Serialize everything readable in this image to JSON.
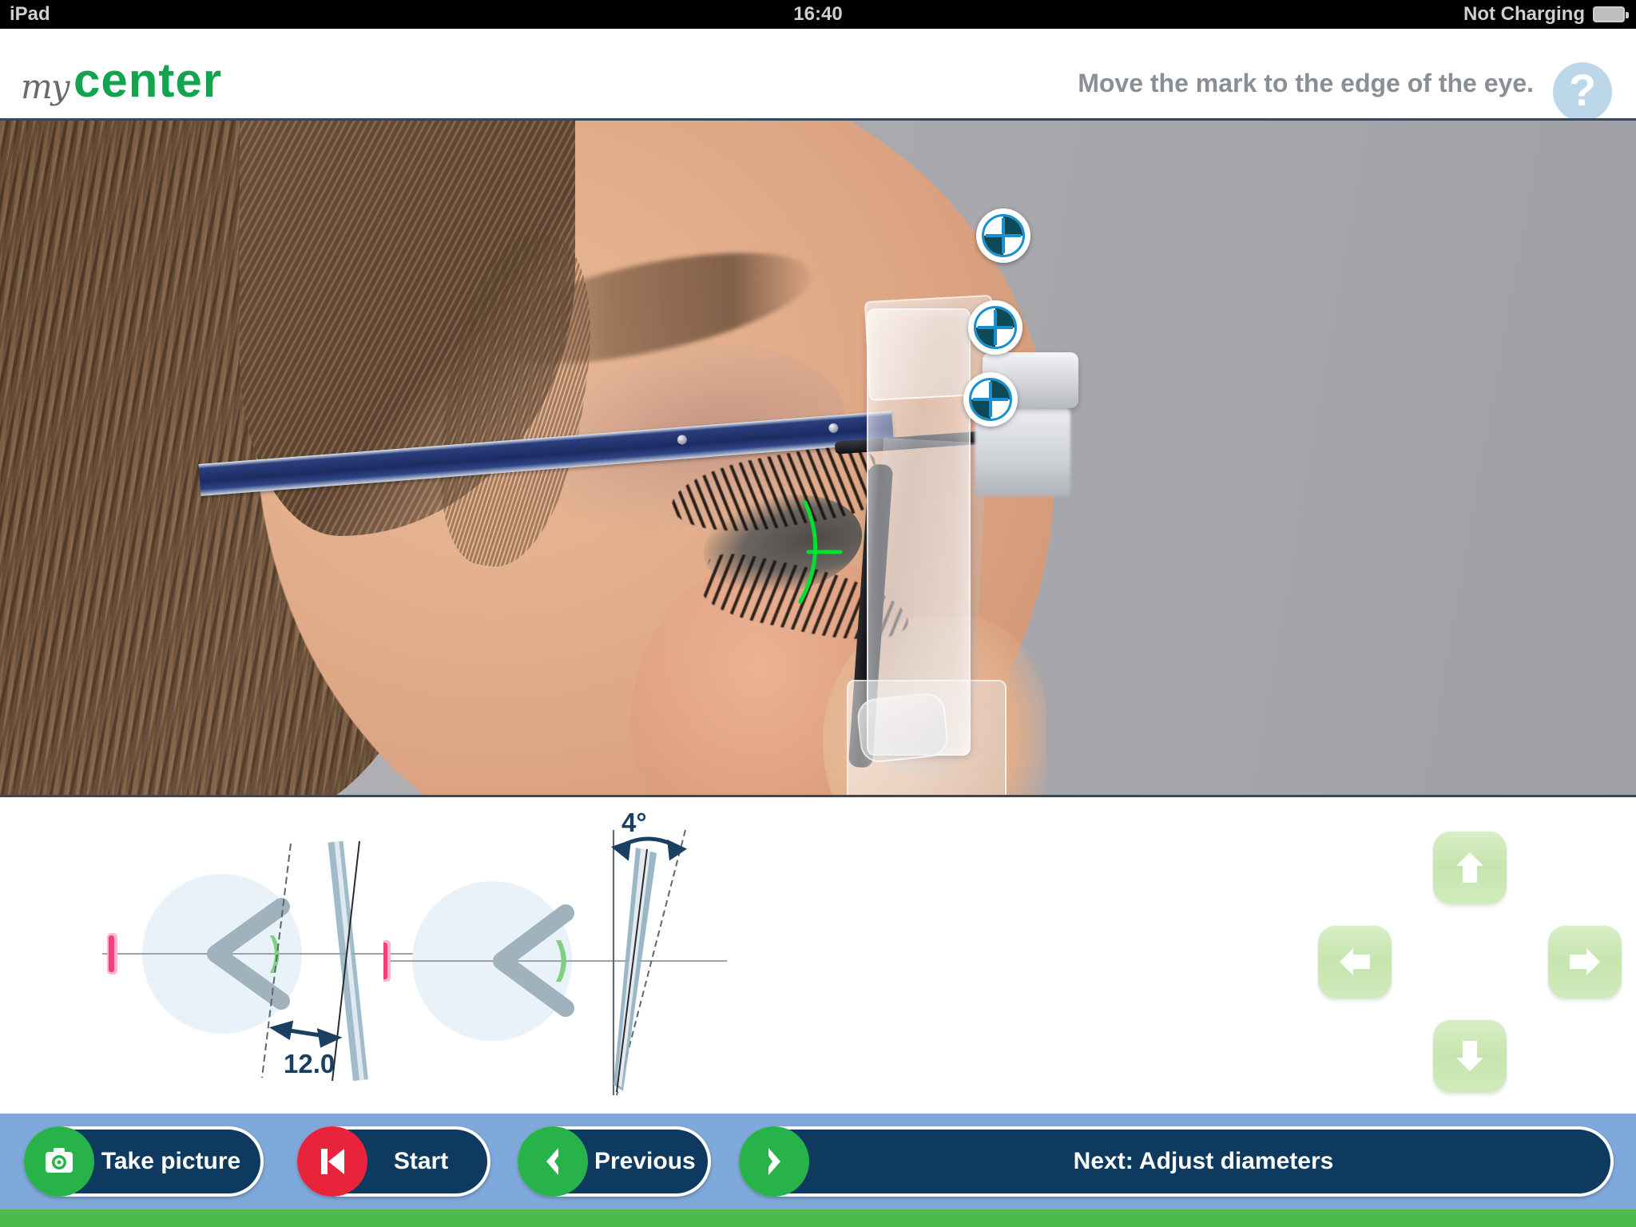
{
  "status_bar": {
    "device": "iPad",
    "time": "16:40",
    "charging_status": "Not Charging",
    "battery_icon": "battery-icon"
  },
  "header": {
    "logo_script": "my",
    "logo_word": "center",
    "instruction": "Move the mark to the edge of the eye.",
    "help_label": "?",
    "brand_green": "#12a44e",
    "help_bg": "#bcd7e9"
  },
  "photo": {
    "alt": "profile-photo-of-woman-wearing-glasses-with-measuring-clip",
    "markers": [
      {
        "name": "fiducial-marker-1"
      },
      {
        "name": "fiducial-marker-2"
      },
      {
        "name": "fiducial-marker-3"
      }
    ],
    "eye_edge_marker": "green-cornea-arc-marker",
    "marker_colors": {
      "ring": "#1a8fd0",
      "quadrant": "#0d4a58",
      "eye_marker": "#00e033"
    }
  },
  "diagrams": {
    "vertex_distance": {
      "label": "12.0",
      "name": "vertex-distance-diagram",
      "unit_implied": "mm"
    },
    "pantoscopic_tilt": {
      "label": "4°",
      "name": "pantoscopic-tilt-diagram"
    },
    "colors": {
      "eyeball": "#e8f2f8",
      "retina_mark": "#f0417a",
      "cornea": "#7fd17f",
      "eyelid": "#9fb2bd",
      "annotation": "#1b3f63",
      "lens": "#8fafc0"
    }
  },
  "dpad": {
    "up": "move-up",
    "left": "move-left",
    "right": "move-right",
    "down": "move-down",
    "color": "#c6e5ae"
  },
  "toolbar": {
    "buttons": [
      {
        "label": "Take picture",
        "icon": "camera-icon",
        "icon_color": "#27b34a"
      },
      {
        "label": "Start",
        "icon": "skip-back-icon",
        "icon_color": "#e8233c"
      },
      {
        "label": "Previous",
        "icon": "chevron-left-icon",
        "icon_color": "#27b34a"
      },
      {
        "label": "Next: Adjust diameters",
        "icon": "chevron-right-icon",
        "icon_color": "#27b34a"
      }
    ],
    "bar_color": "#7fa9da",
    "button_color": "#0e3a5f",
    "strip_color": "#4cbb4c"
  }
}
